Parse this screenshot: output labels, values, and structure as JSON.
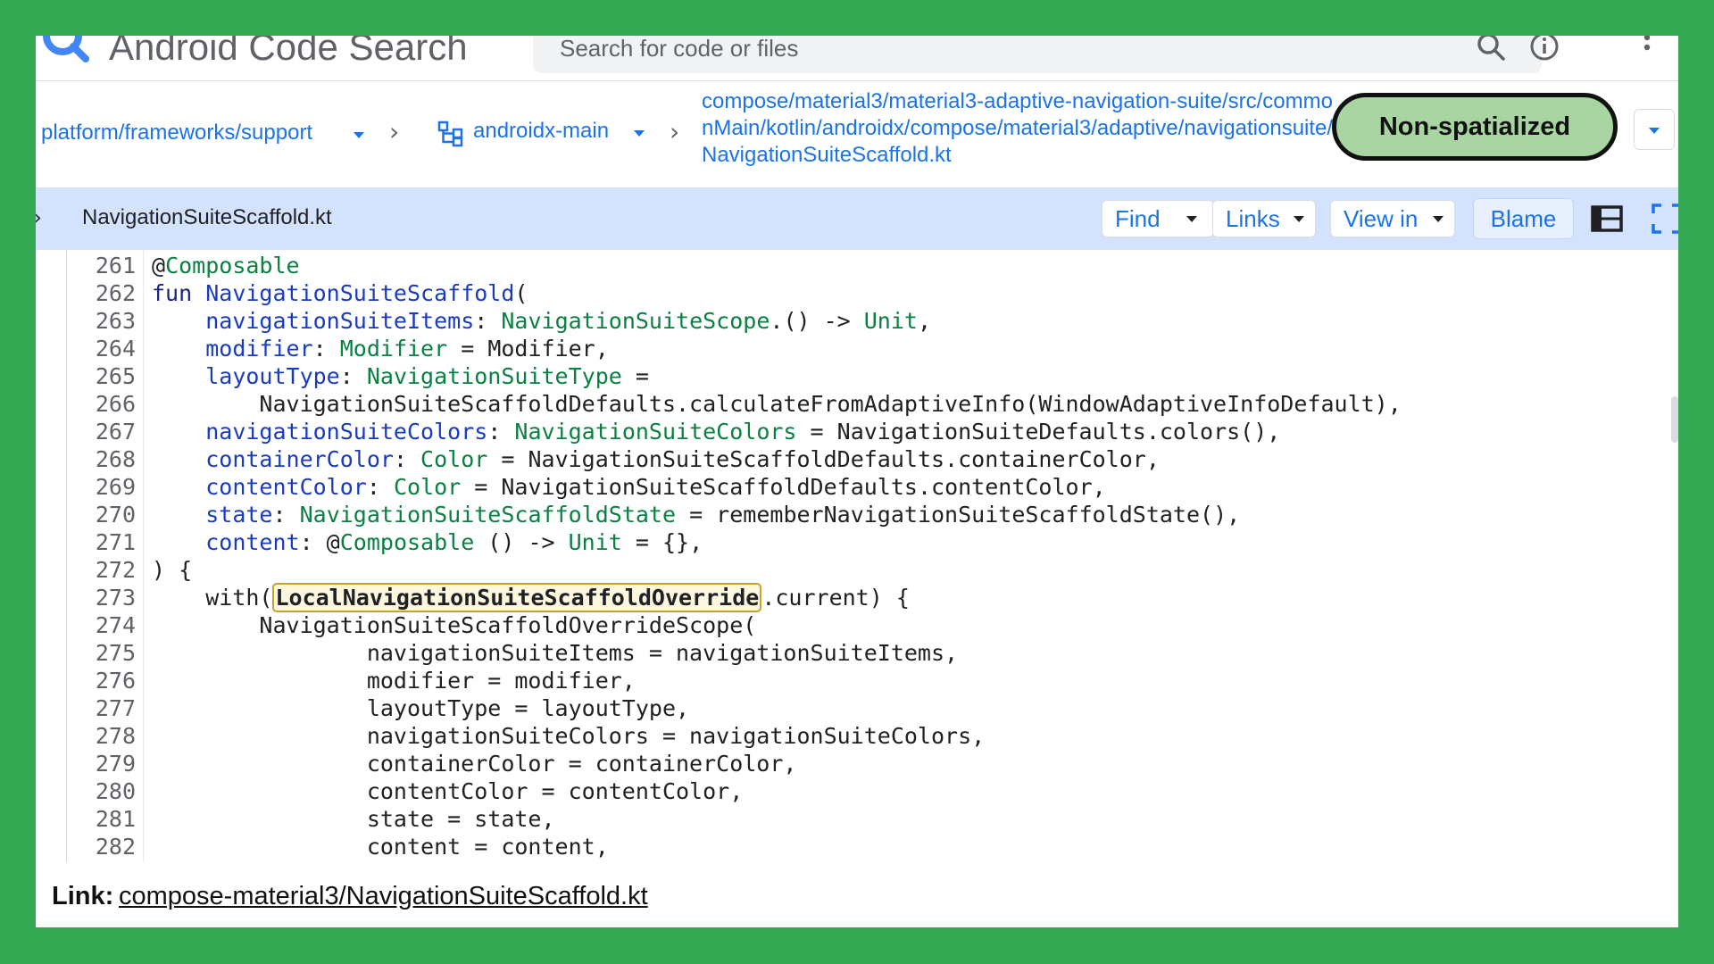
{
  "app": {
    "title": "Android Code Search"
  },
  "search": {
    "placeholder": "Search for code or files"
  },
  "breadcrumb": {
    "repo": "platform/frameworks/support",
    "branch": "androidx-main",
    "path": "compose/material3/material3-adaptive-navigation-suite/src/commonMain/kotlin/androidx/compose/material3/adaptive/navigationsuite/NavigationSuiteScaffold.kt",
    "separator": "›"
  },
  "spatial_toggle": {
    "label": "Non-spatialized"
  },
  "file_header": {
    "file_name": "NavigationSuiteScaffold.kt",
    "find_label": "Find",
    "links_label": "Links",
    "view_in_label": "View in",
    "blame_label": "Blame"
  },
  "code": {
    "lines": [
      {
        "n": "261",
        "segments": [
          {
            "t": "@",
            "c": ""
          },
          {
            "t": "Composable",
            "c": "typ"
          }
        ]
      },
      {
        "n": "262",
        "segments": [
          {
            "t": "fun ",
            "c": "kw"
          },
          {
            "t": "NavigationSuiteScaffold",
            "c": "prm"
          },
          {
            "t": "(",
            "c": ""
          }
        ]
      },
      {
        "n": "263",
        "segments": [
          {
            "t": "    ",
            "c": ""
          },
          {
            "t": "navigationSuiteItems",
            "c": "prm"
          },
          {
            "t": ": ",
            "c": ""
          },
          {
            "t": "NavigationSuiteScope",
            "c": "typ"
          },
          {
            "t": ".() -> ",
            "c": ""
          },
          {
            "t": "Unit",
            "c": "typ"
          },
          {
            "t": ",",
            "c": ""
          }
        ]
      },
      {
        "n": "264",
        "segments": [
          {
            "t": "    ",
            "c": ""
          },
          {
            "t": "modifier",
            "c": "prm"
          },
          {
            "t": ": ",
            "c": ""
          },
          {
            "t": "Modifier",
            "c": "typ"
          },
          {
            "t": " = Modifier,",
            "c": ""
          }
        ]
      },
      {
        "n": "265",
        "segments": [
          {
            "t": "    ",
            "c": ""
          },
          {
            "t": "layoutType",
            "c": "prm"
          },
          {
            "t": ": ",
            "c": ""
          },
          {
            "t": "NavigationSuiteType",
            "c": "typ"
          },
          {
            "t": " =",
            "c": ""
          }
        ]
      },
      {
        "n": "266",
        "segments": [
          {
            "t": "        NavigationSuiteScaffoldDefaults.calculateFromAdaptiveInfo(WindowAdaptiveInfoDefault),",
            "c": ""
          }
        ]
      },
      {
        "n": "267",
        "segments": [
          {
            "t": "    ",
            "c": ""
          },
          {
            "t": "navigationSuiteColors",
            "c": "prm"
          },
          {
            "t": ": ",
            "c": ""
          },
          {
            "t": "NavigationSuiteColors",
            "c": "typ"
          },
          {
            "t": " = NavigationSuiteDefaults.colors(),",
            "c": ""
          }
        ]
      },
      {
        "n": "268",
        "segments": [
          {
            "t": "    ",
            "c": ""
          },
          {
            "t": "containerColor",
            "c": "prm"
          },
          {
            "t": ": ",
            "c": ""
          },
          {
            "t": "Color",
            "c": "typ"
          },
          {
            "t": " = NavigationSuiteScaffoldDefaults.containerColor,",
            "c": ""
          }
        ]
      },
      {
        "n": "269",
        "segments": [
          {
            "t": "    ",
            "c": ""
          },
          {
            "t": "contentColor",
            "c": "prm"
          },
          {
            "t": ": ",
            "c": ""
          },
          {
            "t": "Color",
            "c": "typ"
          },
          {
            "t": " = NavigationSuiteScaffoldDefaults.contentColor,",
            "c": ""
          }
        ]
      },
      {
        "n": "270",
        "segments": [
          {
            "t": "    ",
            "c": ""
          },
          {
            "t": "state",
            "c": "prm"
          },
          {
            "t": ": ",
            "c": ""
          },
          {
            "t": "NavigationSuiteScaffoldState",
            "c": "typ"
          },
          {
            "t": " = rememberNavigationSuiteScaffoldState(),",
            "c": ""
          }
        ]
      },
      {
        "n": "271",
        "segments": [
          {
            "t": "    ",
            "c": ""
          },
          {
            "t": "content",
            "c": "prm"
          },
          {
            "t": ": @",
            "c": ""
          },
          {
            "t": "Composable",
            "c": "typ"
          },
          {
            "t": " () -> ",
            "c": ""
          },
          {
            "t": "Unit",
            "c": "typ"
          },
          {
            "t": " = {},",
            "c": ""
          }
        ]
      },
      {
        "n": "272",
        "segments": [
          {
            "t": ") {",
            "c": ""
          }
        ]
      },
      {
        "n": "273",
        "segments": [
          {
            "t": "    with(",
            "c": ""
          },
          {
            "t": "LocalNavigationSuiteScaffoldOverride",
            "c": "hl"
          },
          {
            "t": ".current) {",
            "c": ""
          }
        ]
      },
      {
        "n": "274",
        "segments": [
          {
            "t": "        NavigationSuiteScaffoldOverrideScope(",
            "c": ""
          }
        ]
      },
      {
        "n": "275",
        "segments": [
          {
            "t": "                navigationSuiteItems = navigationSuiteItems,",
            "c": ""
          }
        ]
      },
      {
        "n": "276",
        "segments": [
          {
            "t": "                modifier = modifier,",
            "c": ""
          }
        ]
      },
      {
        "n": "277",
        "segments": [
          {
            "t": "                layoutType = layoutType,",
            "c": ""
          }
        ]
      },
      {
        "n": "278",
        "segments": [
          {
            "t": "                navigationSuiteColors = navigationSuiteColors,",
            "c": ""
          }
        ]
      },
      {
        "n": "279",
        "segments": [
          {
            "t": "                containerColor = containerColor,",
            "c": ""
          }
        ]
      },
      {
        "n": "280",
        "segments": [
          {
            "t": "                contentColor = contentColor,",
            "c": ""
          }
        ]
      },
      {
        "n": "281",
        "segments": [
          {
            "t": "                state = state,",
            "c": ""
          }
        ]
      },
      {
        "n": "282",
        "segments": [
          {
            "t": "                content = content,",
            "c": ""
          }
        ]
      }
    ]
  },
  "bottom_link": {
    "label": "Link:",
    "url_text": "compose-material3/NavigationSuiteScaffold.kt"
  },
  "colors": {
    "frame_green": "#34a853",
    "link_blue": "#1a73e8",
    "file_header_bg": "#d3e3fd",
    "toggle_green": "#a8d5a2",
    "highlight_bg": "#fef7e0"
  },
  "icons": [
    "logo-icon",
    "search-icon",
    "info-icon",
    "more-vert-icon",
    "branch-icon",
    "chevron-right-icon",
    "caret-down-icon",
    "layout-icon",
    "fullscreen-icon"
  ]
}
